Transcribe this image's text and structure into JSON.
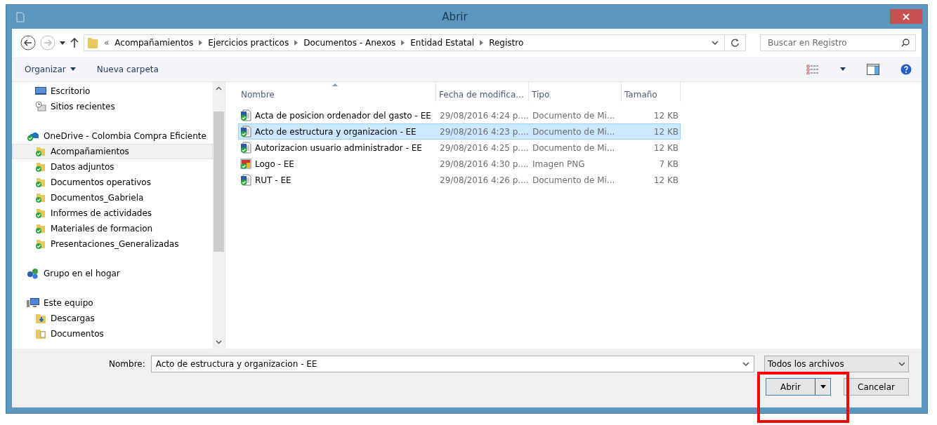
{
  "window": {
    "title": "Abrir"
  },
  "address": {
    "overflow": "«",
    "crumbs": [
      "Acompañamientos",
      "Ejercicios practicos",
      "Documentos - Anexos",
      "Entidad Estatal",
      "Registro"
    ]
  },
  "search": {
    "placeholder": "Buscar en Registro"
  },
  "toolbar": {
    "organize": "Organizar",
    "new_folder": "Nueva carpeta"
  },
  "sidebar": {
    "sections": [
      {
        "children": [
          {
            "label": "Escritorio",
            "kind": "desktop",
            "selected": false
          },
          {
            "label": "Sitios recientes",
            "kind": "recent",
            "selected": false
          }
        ]
      },
      {
        "label": "OneDrive - Colombia Compra Eficiente",
        "kind": "onedrive",
        "children": [
          {
            "label": "Acompañamientos",
            "kind": "synced-folder",
            "selected": true
          },
          {
            "label": "Datos adjuntos",
            "kind": "synced-folder",
            "selected": false
          },
          {
            "label": "Documentos operativos",
            "kind": "synced-folder",
            "selected": false
          },
          {
            "label": "Documentos_Gabriela",
            "kind": "synced-folder",
            "selected": false
          },
          {
            "label": "Informes de actividades",
            "kind": "synced-folder",
            "selected": false
          },
          {
            "label": "Materiales de formacion",
            "kind": "synced-folder",
            "selected": false
          },
          {
            "label": "Presentaciones_Generalizadas",
            "kind": "synced-folder",
            "selected": false
          }
        ]
      },
      {
        "label": "Grupo en el hogar",
        "kind": "homegroup"
      },
      {
        "label": "Este equipo",
        "kind": "computer",
        "children": [
          {
            "label": "Descargas",
            "kind": "downloads",
            "selected": false
          },
          {
            "label": "Documentos",
            "kind": "documents",
            "selected": false
          }
        ]
      }
    ]
  },
  "table": {
    "columns": [
      "Nombre",
      "Fecha de modifica...",
      "Tipo",
      "Tamaño"
    ],
    "rows": [
      {
        "kind": "document",
        "name": "Acta de posicion ordenador del gasto - EE",
        "date": "29/08/2016 4:24 p....",
        "type": "Documento de Mi...",
        "size": "12 KB",
        "selected": false
      },
      {
        "kind": "document",
        "name": "Acto de estructura y organizacion - EE",
        "date": "29/08/2016 4:23 p....",
        "type": "Documento de Mi...",
        "size": "12 KB",
        "selected": true
      },
      {
        "kind": "document",
        "name": "Autorizacion usuario administrador - EE",
        "date": "29/08/2016 4:25 p....",
        "type": "Documento de Mi...",
        "size": "12 KB",
        "selected": false
      },
      {
        "kind": "image",
        "name": "Logo - EE",
        "date": "29/08/2016 4:30 p....",
        "type": "Imagen PNG",
        "size": "7 KB",
        "selected": false
      },
      {
        "kind": "document",
        "name": "RUT - EE",
        "date": "29/08/2016 4:26 p....",
        "type": "Documento de Mi...",
        "size": "12 KB",
        "selected": false
      }
    ]
  },
  "footer": {
    "name_label": "Nombre:",
    "name_value": "Acto de estructura y organizacion - EE",
    "filter": "Todos los archivos",
    "buttons": [
      "Abrir",
      "Cancelar"
    ]
  }
}
